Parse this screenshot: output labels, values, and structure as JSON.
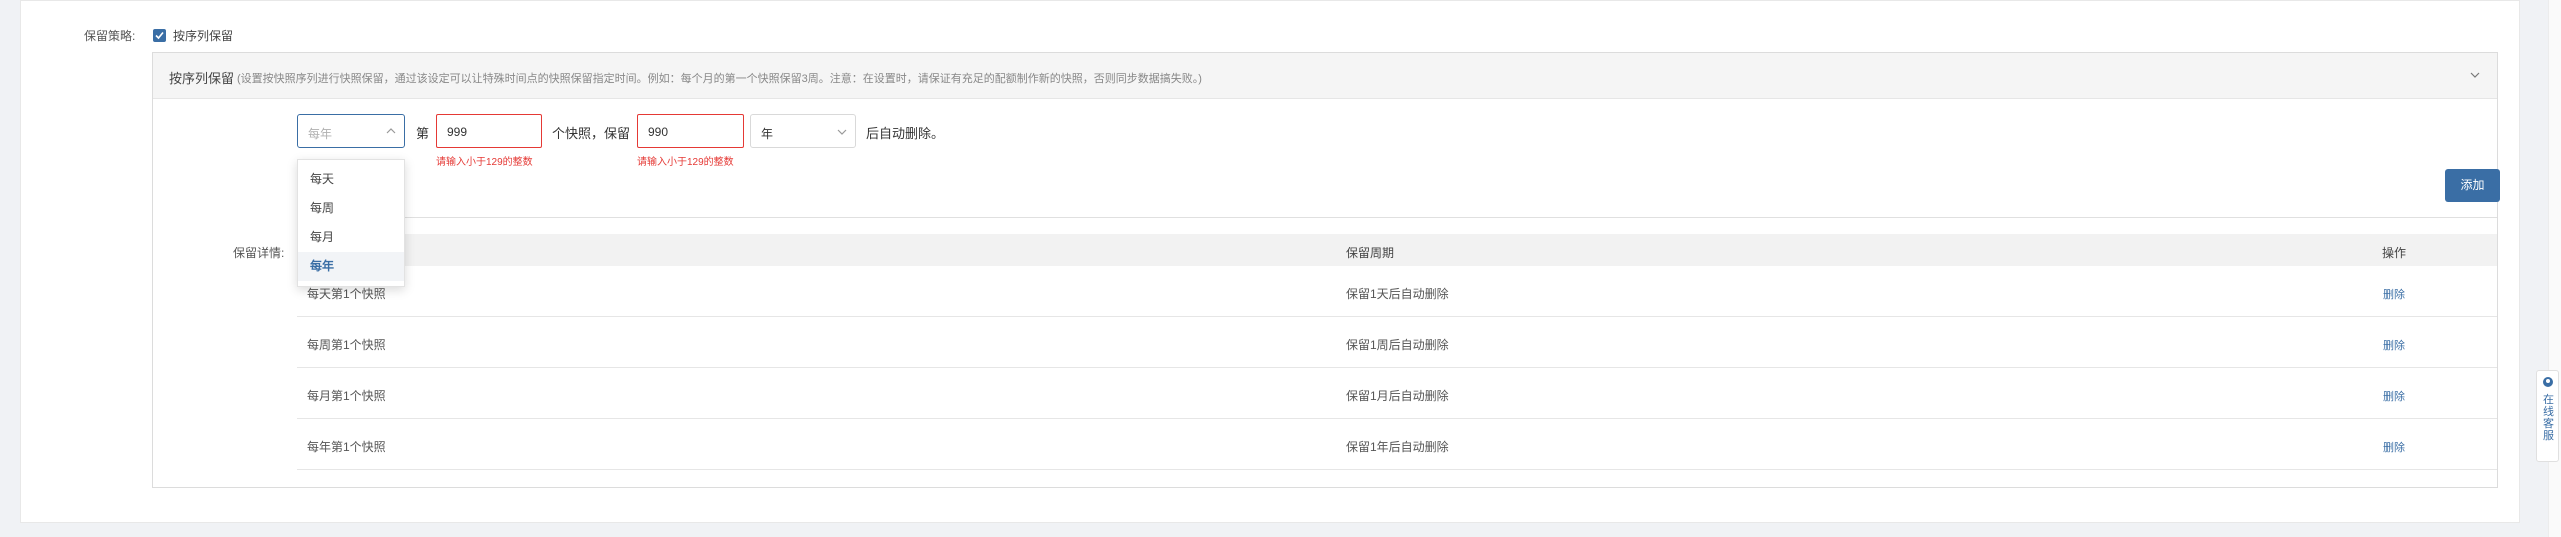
{
  "policy": {
    "label": "保留策略:",
    "checkbox_label": "按序列保留",
    "checked": true
  },
  "panel": {
    "title": "按序列保留",
    "description": "(设置按快照序列进行快照保留，通过该设定可以让特殊时间点的快照保留指定时间。例如：每个月的第一个快照保留3周。注意：在设置时，请保证有充足的配额制作新的快照，否则同步数据搞失败。)"
  },
  "form": {
    "period_select": {
      "placeholder": "每年",
      "selected": ""
    },
    "prefix": "第",
    "count_input": {
      "value": "999",
      "error": "请输入小于129的整数"
    },
    "middle_text": "个快照，保留",
    "keep_input": {
      "value": "990",
      "error": "请输入小于129的整数"
    },
    "unit_select": {
      "value": "年"
    },
    "suffix": "后自动删除。"
  },
  "dropdown": {
    "options": [
      "每天",
      "每周",
      "每月",
      "每年"
    ],
    "selected": "每年"
  },
  "add_button": "添加",
  "details": {
    "label": "保留详情:",
    "columns": [
      "",
      "保留周期",
      "操作"
    ],
    "rows": [
      {
        "name": "每天第1个快照",
        "period": "保留1天后自动删除",
        "action": "删除"
      },
      {
        "name": "每周第1个快照",
        "period": "保留1周后自动删除",
        "action": "删除"
      },
      {
        "name": "每月第1个快照",
        "period": "保留1月后自动删除",
        "action": "删除"
      },
      {
        "name": "每年第1个快照",
        "period": "保留1年后自动删除",
        "action": "删除"
      }
    ]
  },
  "side_widget": {
    "label": "在线客服",
    "icon": "customer-service-icon"
  },
  "colors": {
    "primary": "#3a6ea5",
    "error": "#e53935"
  }
}
